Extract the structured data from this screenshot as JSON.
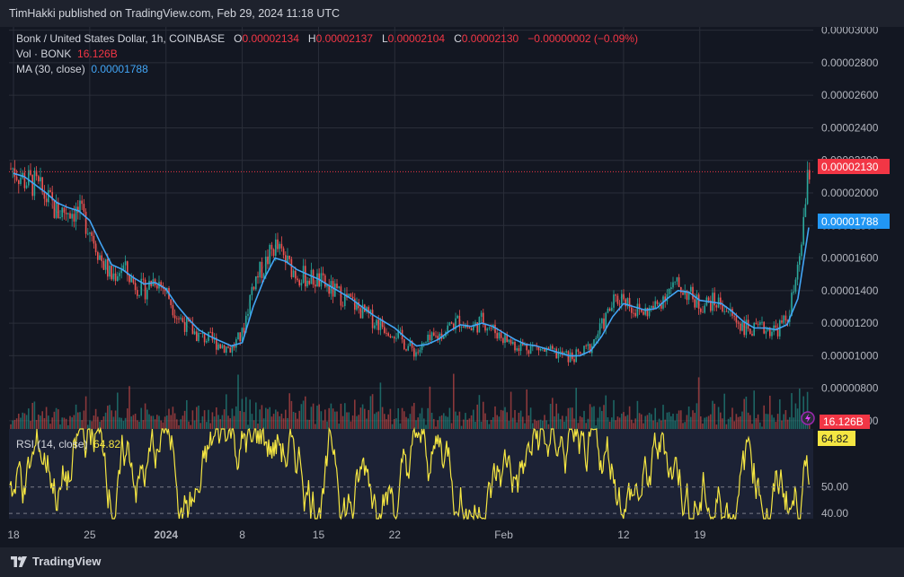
{
  "header": {
    "publisher": "TimHakki published on TradingView.com, Feb 29, 2024 11:18 UTC"
  },
  "legend": {
    "symbol": "Bonk / United States Dollar, 1h, COINBASE",
    "o_label": "O",
    "o_value": "0.00002134",
    "h_label": "H",
    "h_value": "0.00002137",
    "l_label": "L",
    "l_value": "0.00002104",
    "c_label": "C",
    "c_value": "0.00002130",
    "change": "−0.00000002 (−0.09%)",
    "vol_label": "Vol · BONK",
    "vol_value": "16.126B",
    "ma_label": "MA (30, close)",
    "ma_value": "0.00001788",
    "rsi_label": "RSI (14, close)",
    "rsi_value": "64.82"
  },
  "badges": {
    "price": "0.00002130",
    "ma": "0.00001788",
    "vol": "16.126B",
    "rsi": "64.82"
  },
  "brand": {
    "name": "TradingView"
  },
  "colors": {
    "up": "#26a69a",
    "down": "#ef5350",
    "ma": "#42a5f5",
    "rsi": "#f5e642",
    "price_badge": "#f23645",
    "ma_badge": "#2196f3"
  },
  "chart_data": {
    "type": "line",
    "x": [
      "Dec 18",
      "Dec 19",
      "Dec 20",
      "Dec 21",
      "Dec 22",
      "Dec 23",
      "Dec 24",
      "Dec 25",
      "Dec 26",
      "Dec 27",
      "Dec 28",
      "Dec 29",
      "Dec 30",
      "Dec 31",
      "Jan 1",
      "Jan 2",
      "Jan 3",
      "Jan 4",
      "Jan 5",
      "Jan 6",
      "Jan 7",
      "Jan 8",
      "Jan 9",
      "Jan 10",
      "Jan 11",
      "Jan 12",
      "Jan 13",
      "Jan 14",
      "Jan 15",
      "Jan 16",
      "Jan 17",
      "Jan 18",
      "Jan 19",
      "Jan 20",
      "Jan 21",
      "Jan 22",
      "Jan 23",
      "Jan 24",
      "Jan 25",
      "Jan 26",
      "Jan 27",
      "Jan 28",
      "Jan 29",
      "Jan 30",
      "Jan 31",
      "Feb 1",
      "Feb 2",
      "Feb 3",
      "Feb 4",
      "Feb 5",
      "Feb 6",
      "Feb 7",
      "Feb 8",
      "Feb 9",
      "Feb 10",
      "Feb 11",
      "Feb 12",
      "Feb 13",
      "Feb 14",
      "Feb 15",
      "Feb 16",
      "Feb 17",
      "Feb 18",
      "Feb 19",
      "Feb 20",
      "Feb 21",
      "Feb 22",
      "Feb 23",
      "Feb 24",
      "Feb 25",
      "Feb 26",
      "Feb 27",
      "Feb 28",
      "Feb 29"
    ],
    "series": [
      {
        "name": "Bonk / United States Dollar",
        "values": [
          2.15e-05,
          2.08e-05,
          2.05e-05,
          1.97e-05,
          1.88e-05,
          1.9e-05,
          1.88e-05,
          1.79e-05,
          1.6e-05,
          1.48e-05,
          1.55e-05,
          1.45e-05,
          1.4e-05,
          1.48e-05,
          1.4e-05,
          1.25e-05,
          1.18e-05,
          1.12e-05,
          1.1e-05,
          1.07e-05,
          1.04e-05,
          1.13e-05,
          1.45e-05,
          1.55e-05,
          1.68e-05,
          1.58e-05,
          1.5e-05,
          1.48e-05,
          1.46e-05,
          1.41e-05,
          1.37e-05,
          1.33e-05,
          1.27e-05,
          1.22e-05,
          1.18e-05,
          1.15e-05,
          1.07e-05,
          1.02e-05,
          1.08e-05,
          1.12e-05,
          1.18e-05,
          1.22e-05,
          1.16e-05,
          1.22e-05,
          1.16e-05,
          1.11e-05,
          1.07e-05,
          1.06e-05,
          1.05e-05,
          1.02e-05,
          1.01e-05,
          9.9e-06,
          1e-05,
          1.06e-05,
          1.18e-05,
          1.32e-05,
          1.37e-05,
          1.28e-05,
          1.27e-05,
          1.3e-05,
          1.4e-05,
          1.43e-05,
          1.38e-05,
          1.31e-05,
          1.33e-05,
          1.32e-05,
          1.24e-05,
          1.18e-05,
          1.15e-05,
          1.17e-05,
          1.16e-05,
          1.22e-05,
          1.5e-05,
          2.13e-05
        ]
      },
      {
        "name": "MA (30, close)",
        "values": [
          2.12e-05,
          2.1e-05,
          2.05e-05,
          2e-05,
          1.94e-05,
          1.91e-05,
          1.89e-05,
          1.83e-05,
          1.69e-05,
          1.56e-05,
          1.53e-05,
          1.48e-05,
          1.44e-05,
          1.45e-05,
          1.41e-05,
          1.31e-05,
          1.23e-05,
          1.16e-05,
          1.12e-05,
          1.09e-05,
          1.06e-05,
          1.08e-05,
          1.3e-05,
          1.47e-05,
          1.6e-05,
          1.58e-05,
          1.53e-05,
          1.5e-05,
          1.47e-05,
          1.43e-05,
          1.39e-05,
          1.35e-05,
          1.3e-05,
          1.25e-05,
          1.21e-05,
          1.17e-05,
          1.11e-05,
          1.06e-05,
          1.07e-05,
          1.1e-05,
          1.15e-05,
          1.19e-05,
          1.18e-05,
          1.2e-05,
          1.18e-05,
          1.14e-05,
          1.1e-05,
          1.07e-05,
          1.06e-05,
          1.04e-05,
          1.02e-05,
          1e-05,
          1e-05,
          1.03e-05,
          1.12e-05,
          1.24e-05,
          1.32e-05,
          1.3e-05,
          1.28e-05,
          1.29e-05,
          1.35e-05,
          1.4e-05,
          1.39e-05,
          1.34e-05,
          1.33e-05,
          1.32e-05,
          1.27e-05,
          1.21e-05,
          1.17e-05,
          1.17e-05,
          1.16e-05,
          1.19e-05,
          1.35e-05,
          1.788e-05
        ]
      }
    ],
    "y_ticks": [
      "0.00003000",
      "0.00002800",
      "0.00002600",
      "0.00002400",
      "0.00002200",
      "0.00002000",
      "0.00001800",
      "0.00001600",
      "0.00001400",
      "0.00001200",
      "0.00001000",
      "0.00000800",
      "0.00000600"
    ],
    "ylim": [
      5.5e-06,
      3.02e-05
    ],
    "x_ticks": [
      {
        "label": "18",
        "at": "Dec 18"
      },
      {
        "label": "25",
        "at": "Dec 25"
      },
      {
        "label": "2024",
        "at": "Jan 1"
      },
      {
        "label": "8",
        "at": "Jan 8"
      },
      {
        "label": "15",
        "at": "Jan 15"
      },
      {
        "label": "22",
        "at": "Jan 22"
      },
      {
        "label": "Feb",
        "at": "Feb 1"
      },
      {
        "label": "12",
        "at": "Feb 12"
      },
      {
        "label": "19",
        "at": "Feb 19"
      }
    ],
    "last_price": 2.13e-05,
    "rsi_ticks": [
      "50.00",
      "40.00"
    ],
    "rsi_ylim": [
      38,
      72
    ],
    "grid": true
  }
}
